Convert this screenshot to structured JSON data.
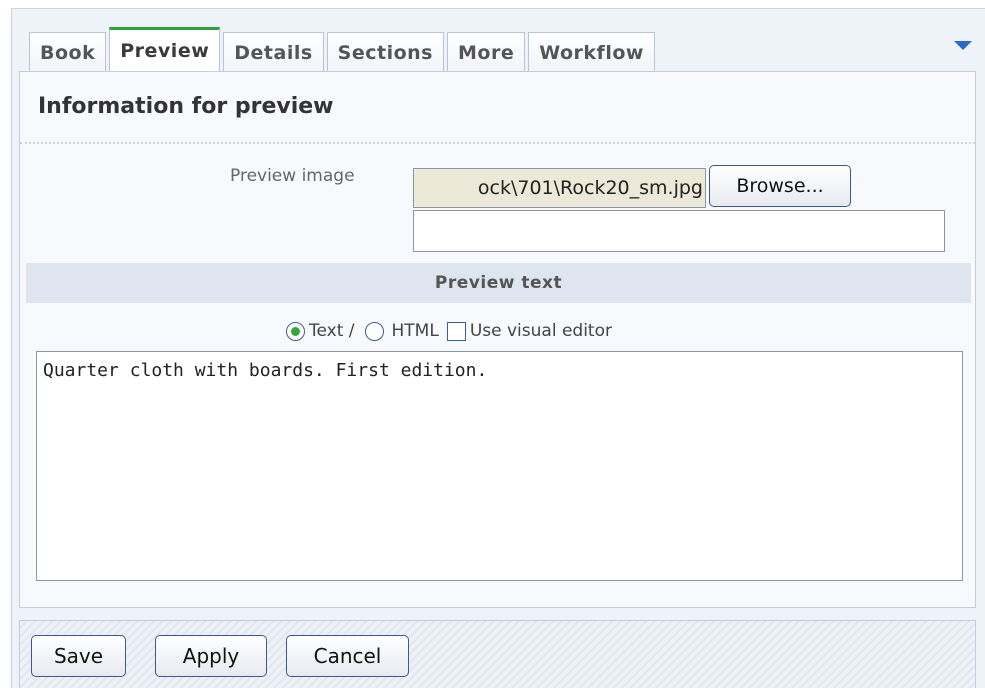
{
  "tabs": [
    {
      "label": "Book",
      "active": false
    },
    {
      "label": "Preview",
      "active": true
    },
    {
      "label": "Details",
      "active": false
    },
    {
      "label": "Sections",
      "active": false
    },
    {
      "label": "More",
      "active": false
    },
    {
      "label": "Workflow",
      "active": false
    }
  ],
  "tab_menu_icon": "chevron-down-icon",
  "section": {
    "title": "Information for preview",
    "preview_image_label": "Preview image",
    "preview_image_value": "ock\\701\\Rock20_sm.jpg",
    "browse_label": "Browse...",
    "second_input_value": ""
  },
  "preview_text": {
    "header": "Preview text",
    "option_text": "Text /",
    "option_html": "HTML",
    "option_visual_editor": "Use visual editor",
    "selected": "text",
    "content": "Quarter cloth with boards. First edition."
  },
  "footer": {
    "save_label": "Save",
    "apply_label": "Apply",
    "cancel_label": "Cancel"
  },
  "colors": {
    "active_tab_accent": "#2fa33a",
    "menu_arrow": "#2a6bc9",
    "panel_bg": "#f7f9fd"
  }
}
